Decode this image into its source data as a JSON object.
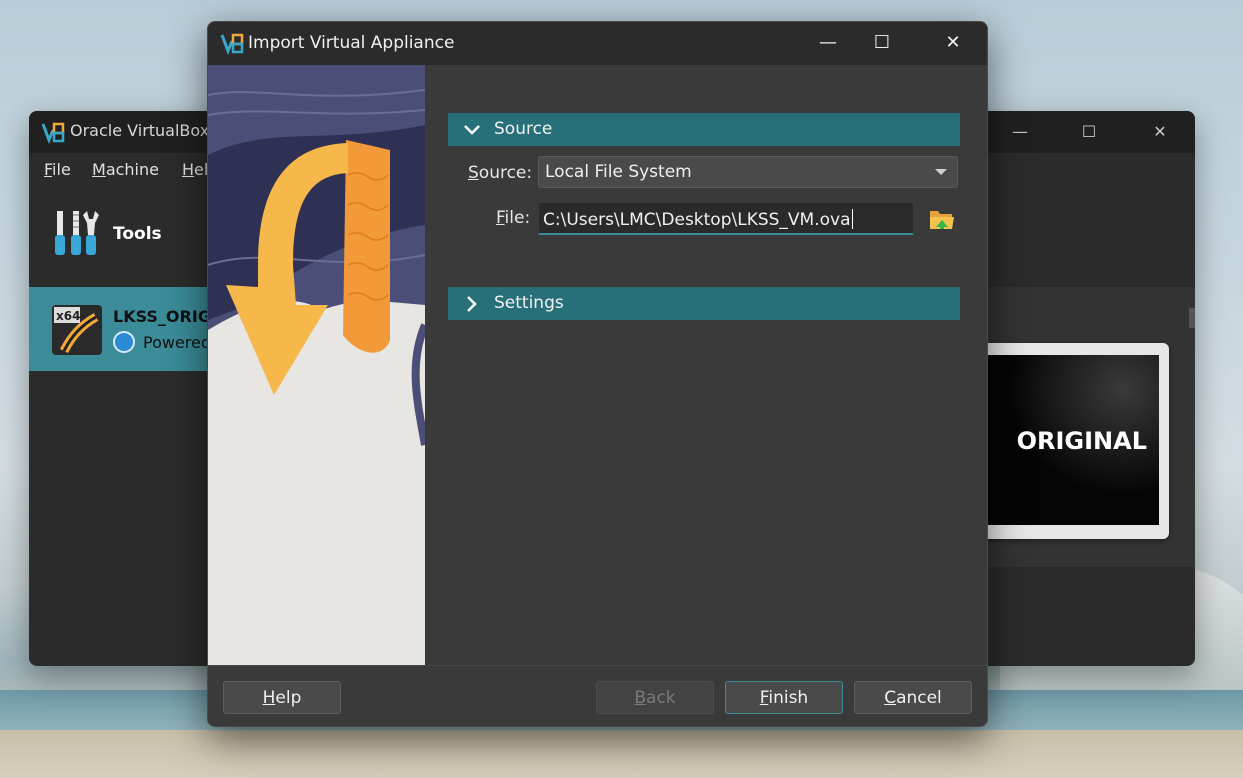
{
  "main_window": {
    "title": "Oracle VirtualBox",
    "menu": [
      {
        "label": "File",
        "mnemonic": "F",
        "rest": "ile"
      },
      {
        "label": "Machine",
        "mnemonic": "M",
        "rest": "achine"
      },
      {
        "label": "Hel",
        "mnemonic": "H",
        "rest": "el"
      }
    ],
    "tools_label": "Tools",
    "vm": {
      "name": "LKSS_ORIG",
      "state": "Powered",
      "arch_badge": "x64"
    },
    "preview_text": "ORIGINAL",
    "controls": [
      "minimize-icon",
      "maximize-icon",
      "close-icon"
    ]
  },
  "dialog": {
    "title": "Import Virtual Appliance",
    "controls": {
      "minimize": "—",
      "maximize": "☐",
      "close": "✕"
    },
    "source_section": {
      "header": "Source",
      "expanded": true,
      "source_label_mnemonic": "S",
      "source_label_rest": "ource:",
      "source_value": "Local File System",
      "file_label_mnemonic": "F",
      "file_label_rest": "ile:",
      "file_value": "C:\\Users\\LMC\\Desktop\\LKSS_VM.ova"
    },
    "settings_section": {
      "header": "Settings",
      "expanded": false
    },
    "buttons": {
      "help": {
        "mnemonic": "H",
        "rest": "elp"
      },
      "back": {
        "mnemonic": "B",
        "rest": "ack",
        "disabled": true
      },
      "finish": {
        "mnemonic": "F",
        "rest": "inish"
      },
      "cancel": {
        "mnemonic": "C",
        "rest": "ancel"
      }
    }
  },
  "colors": {
    "section_header": "#276f79",
    "selected_vm": "#3b8b98",
    "accent_arrow": "#f7b84b"
  }
}
